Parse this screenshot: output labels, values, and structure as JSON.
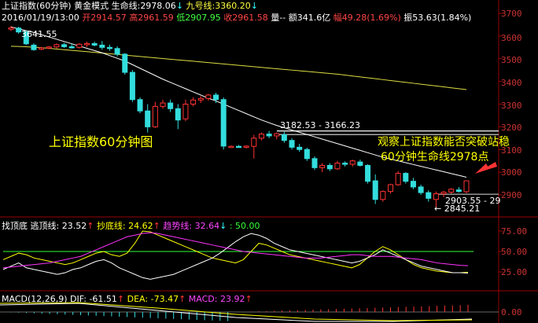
{
  "header": {
    "title": "上证指数(60分钟)",
    "mode": "黄金模式",
    "life_line_label": "生命线:",
    "life_line_value": "2978.06",
    "nine_line_label": "九号线:",
    "nine_line_value": "3360.20"
  },
  "quote": {
    "datetime": "2016/01/19/13:00",
    "open": "开2914.57",
    "high": "高2961.59",
    "low": "低2907.95",
    "close": "收2961.58",
    "volume": "量--",
    "amount": "额341.6亿",
    "change": "幅49.28(1.69%)",
    "amplitude": "振53.63(1.84%)"
  },
  "price_axis": [
    "3700",
    "3600",
    "3500",
    "3400",
    "3300",
    "3200",
    "3100",
    "3000",
    "2900"
  ],
  "annotations": {
    "chart_label": "上证指数60分钟图",
    "note_line1": "观察上证指数能否突破站稳",
    "note_line2": "60分钟生命线2978点",
    "high_mark": "3641.55",
    "resistance_mark": "3182.53 - 3166.23",
    "support_mark": "2903.55 - 29",
    "low_mark": "← 2845.21"
  },
  "oscillator": {
    "name": "找顶底",
    "escape_label": "逃顶线:",
    "escape_value": "23.52",
    "bottom_label": "抄底线:",
    "bottom_value": "24.62",
    "trend_label": "趋势线:",
    "trend_value": "32.64",
    "ref_label": ":",
    "ref_value": "50.00",
    "axis": [
      "75.00",
      "50.00",
      "25.00"
    ]
  },
  "macd": {
    "name": "MACD(12,26,9)",
    "dif_label": "DIF:",
    "dif_value": "-61.51",
    "dea_label": "DEA:",
    "dea_value": "-73.47",
    "macd_label": "MACD:",
    "macd_value": "23.92",
    "axis": [
      "0.00"
    ]
  },
  "colors": {
    "up": "#ff3333",
    "down": "#33dddd",
    "bg": "#000000",
    "grid": "#990000",
    "life_line": "#ffffff",
    "nine_line": "#dddd44",
    "escape": "#ffffff",
    "bottom": "#ffff00",
    "trend": "#ff33ff",
    "ref": "#33ff33"
  },
  "candles": [
    [
      3630,
      3645,
      3622,
      3636
    ],
    [
      3635,
      3641,
      3610,
      3618
    ],
    [
      3618,
      3624,
      3560,
      3566
    ],
    [
      3560,
      3568,
      3535,
      3540
    ],
    [
      3542,
      3552,
      3538,
      3548
    ],
    [
      3548,
      3556,
      3542,
      3552
    ],
    [
      3552,
      3568,
      3545,
      3562
    ],
    [
      3562,
      3570,
      3548,
      3553
    ],
    [
      3553,
      3566,
      3545,
      3550
    ],
    [
      3550,
      3568,
      3545,
      3564
    ],
    [
      3564,
      3575,
      3552,
      3567
    ],
    [
      3567,
      3575,
      3555,
      3560
    ],
    [
      3560,
      3578,
      3540,
      3550
    ],
    [
      3550,
      3562,
      3535,
      3548
    ],
    [
      3545,
      3555,
      3510,
      3520
    ],
    [
      3520,
      3525,
      3430,
      3440
    ],
    [
      3440,
      3450,
      3310,
      3320
    ],
    [
      3320,
      3330,
      3260,
      3270
    ],
    [
      3270,
      3300,
      3175,
      3200
    ],
    [
      3200,
      3310,
      3195,
      3290
    ],
    [
      3290,
      3320,
      3280,
      3305
    ],
    [
      3305,
      3320,
      3265,
      3280
    ],
    [
      3280,
      3300,
      3190,
      3230
    ],
    [
      3235,
      3320,
      3225,
      3300
    ],
    [
      3300,
      3330,
      3290,
      3318
    ],
    [
      3318,
      3335,
      3305,
      3325
    ],
    [
      3325,
      3345,
      3315,
      3340
    ],
    [
      3340,
      3350,
      3305,
      3320
    ],
    [
      3320,
      3330,
      3100,
      3115
    ],
    [
      3112,
      3118,
      3108,
      3114
    ],
    [
      3114,
      3120,
      3108,
      3112
    ],
    [
      3112,
      3118,
      3105,
      3115
    ],
    [
      3114,
      3165,
      3060,
      3150
    ],
    [
      3150,
      3175,
      3140,
      3168
    ],
    [
      3168,
      3182,
      3150,
      3160
    ],
    [
      3160,
      3175,
      3145,
      3170
    ],
    [
      3165,
      3178,
      3130,
      3140
    ],
    [
      3140,
      3150,
      3100,
      3110
    ],
    [
      3110,
      3125,
      3090,
      3100
    ],
    [
      3100,
      3108,
      3050,
      3060
    ],
    [
      3060,
      3070,
      3010,
      3020
    ],
    [
      3020,
      3040,
      3000,
      3030
    ],
    [
      3030,
      3040,
      3005,
      3015
    ],
    [
      3015,
      3050,
      3010,
      3040
    ],
    [
      3040,
      3048,
      3025,
      3035
    ],
    [
      3035,
      3055,
      3025,
      3050
    ],
    [
      3045,
      3055,
      3025,
      3030
    ],
    [
      3030,
      3035,
      2950,
      2960
    ],
    [
      2962,
      2990,
      2860,
      2880
    ],
    [
      2880,
      2920,
      2870,
      2915
    ],
    [
      2915,
      2950,
      2905,
      2945
    ],
    [
      2945,
      3005,
      2940,
      2995
    ],
    [
      2995,
      3000,
      2950,
      2960
    ],
    [
      2960,
      2975,
      2925,
      2935
    ],
    [
      2935,
      2945,
      2900,
      2910
    ],
    [
      2910,
      2920,
      2870,
      2885
    ],
    [
      2880,
      2915,
      2846,
      2905
    ],
    [
      2905,
      2918,
      2890,
      2912
    ],
    [
      2912,
      2930,
      2905,
      2925
    ],
    [
      2922,
      2935,
      2910,
      2915
    ],
    [
      2914,
      2962,
      2908,
      2962
    ]
  ]
}
